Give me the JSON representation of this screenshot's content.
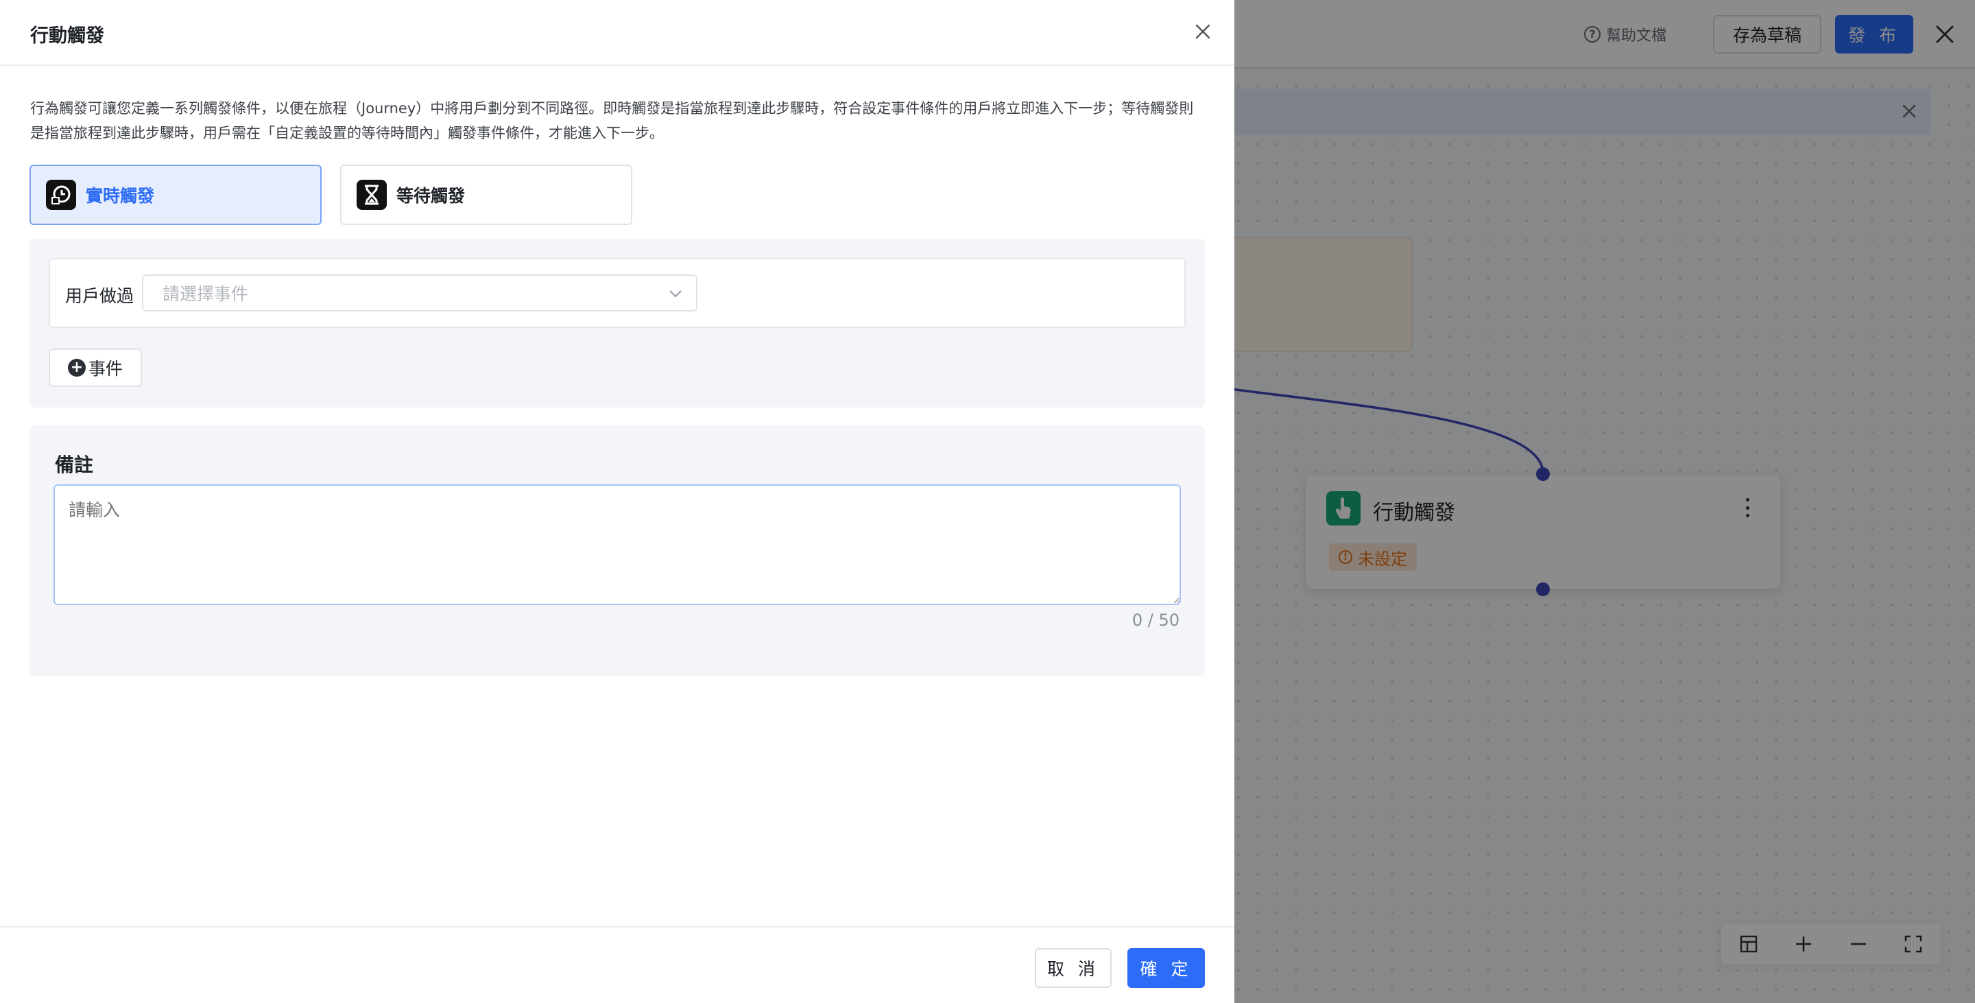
{
  "toolbar": {
    "help_label": "幫助文檔",
    "help_icon": "question-circle-icon",
    "save_draft_label": "存為草稿",
    "publish_label": "發 布"
  },
  "canvas": {
    "node": {
      "title": "行動觸發",
      "icon": "hand-pointer-icon",
      "status_badge": "未設定",
      "status_color": "#e8711b"
    },
    "connector_color": "#3f46b9",
    "zoom_controls": [
      "layout-icon",
      "zoom-in-icon",
      "zoom-out-icon",
      "fullscreen-icon"
    ]
  },
  "drawer": {
    "title": "行動觸發",
    "description": "行為觸發可讓您定義一系列觸發條件，以便在旅程（Journey）中將用戶劃分到不同路徑。即時觸發是指當旅程到達此步驟時，符合設定事件條件的用戶將立即進入下一步；等待觸發則是指當旅程到達此步驟時，用戶需在「自定義設置的等待時間內」觸發事件條件，才能進入下一步。",
    "tabs": [
      {
        "label": "實時觸發",
        "icon": "clock-user-icon",
        "active": true
      },
      {
        "label": "等待觸發",
        "icon": "hourglass-icon",
        "active": false
      }
    ],
    "condition": {
      "label": "用戶做過",
      "event_placeholder": "請選擇事件",
      "add_event_label": "事件"
    },
    "note": {
      "title": "備註",
      "placeholder": "請輸入",
      "value": "",
      "counter": "0 / 50"
    },
    "footer": {
      "cancel_label": "取 消",
      "confirm_label": "確 定"
    }
  },
  "colors": {
    "primary": "#2c6cf6",
    "active_tab_bg": "#e6eefe",
    "overlay": "rgba(0,0,0,0.45)"
  }
}
